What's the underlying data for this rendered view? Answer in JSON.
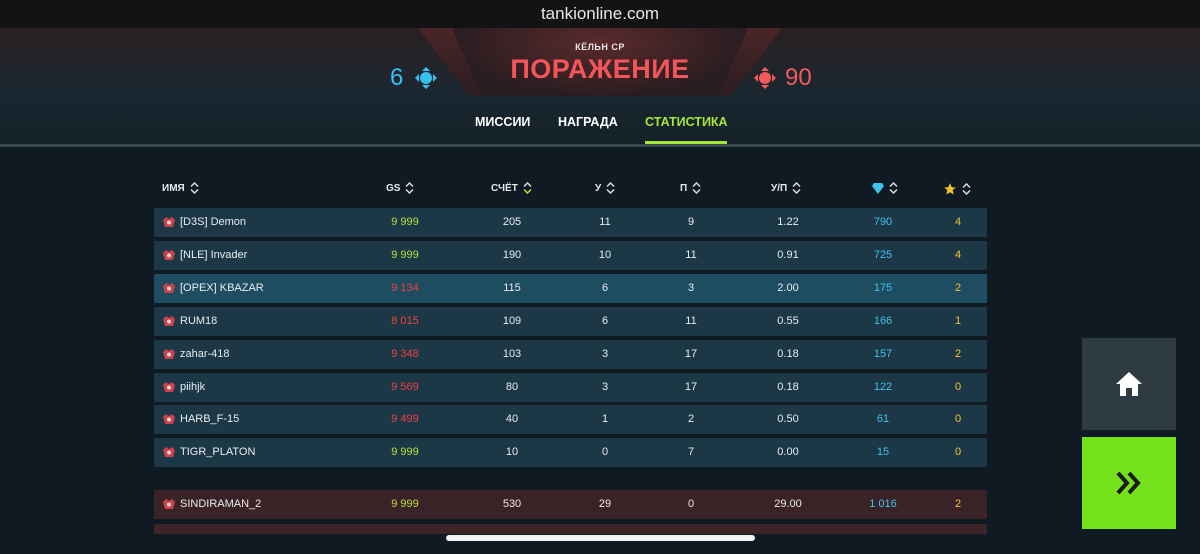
{
  "browser": {
    "url": "tankionline.com"
  },
  "battle": {
    "map_name": "КЁЛЬН CP",
    "result": "ПОРАЖЕНИЕ",
    "blue_score": "6",
    "red_score": "90"
  },
  "tabs": [
    "МИССИИ",
    "НАГРАДА",
    "СТАТИСТИКА"
  ],
  "columns": {
    "name": "ИМЯ",
    "gs": "GS",
    "score": "СЧЁТ",
    "kills": "У",
    "deaths": "П",
    "kd": "У/П"
  },
  "colors": {
    "accent_green": "#a6e83a",
    "defeat_red": "#f3555a",
    "blue_team": "#38bff0",
    "crystal": "#3fc3f0",
    "star": "#f5c42c"
  },
  "blue_team": [
    {
      "name": "[D3S] Demon",
      "gs": "9 999",
      "gs_color": "green",
      "score": "205",
      "kills": "11",
      "deaths": "9",
      "kd": "1.22",
      "crystals": "790",
      "stars": "4"
    },
    {
      "name": "[NLE] Invader",
      "gs": "9 999",
      "gs_color": "green",
      "score": "190",
      "kills": "10",
      "deaths": "11",
      "kd": "0.91",
      "crystals": "725",
      "stars": "4"
    },
    {
      "name": "[OPEX] KBAZAR",
      "gs": "9 134",
      "gs_color": "red",
      "score": "115",
      "kills": "6",
      "deaths": "3",
      "kd": "2.00",
      "crystals": "175",
      "stars": "2"
    },
    {
      "name": "RUM18",
      "gs": "8 015",
      "gs_color": "red",
      "score": "109",
      "kills": "6",
      "deaths": "11",
      "kd": "0.55",
      "crystals": "166",
      "stars": "1"
    },
    {
      "name": "zahar-418",
      "gs": "9 348",
      "gs_color": "red",
      "score": "103",
      "kills": "3",
      "deaths": "17",
      "kd": "0.18",
      "crystals": "157",
      "stars": "2"
    },
    {
      "name": "piihjk",
      "gs": "9 569",
      "gs_color": "red",
      "score": "80",
      "kills": "3",
      "deaths": "17",
      "kd": "0.18",
      "crystals": "122",
      "stars": "0"
    },
    {
      "name": "HARB_F-15",
      "gs": "9 499",
      "gs_color": "red",
      "score": "40",
      "kills": "1",
      "deaths": "2",
      "kd": "0.50",
      "crystals": "61",
      "stars": "0"
    },
    {
      "name": "TIGR_PLATON",
      "gs": "9 999",
      "gs_color": "green",
      "score": "10",
      "kills": "0",
      "deaths": "7",
      "kd": "0.00",
      "crystals": "15",
      "stars": "0"
    }
  ],
  "red_team": [
    {
      "name": "SINDIRAMAN_2",
      "gs": "9 999",
      "gs_color": "green",
      "score": "530",
      "kills": "29",
      "deaths": "0",
      "kd": "29.00",
      "crystals": "1 016",
      "stars": "2"
    }
  ]
}
